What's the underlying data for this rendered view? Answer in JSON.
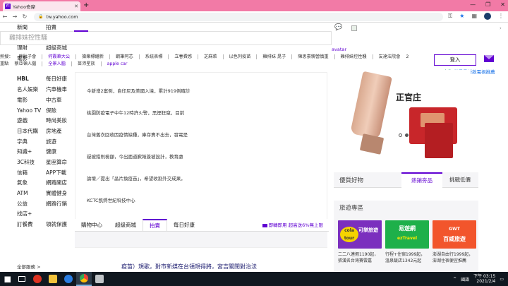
{
  "browser": {
    "tab_title": "Yahoo奇摩",
    "tab_favicon": "Y!",
    "new_tab_label": "+",
    "url": "tw.yahoo.com",
    "window_controls": [
      "—",
      "❐",
      "✕"
    ]
  },
  "header": {
    "search_placeholder": "雞排妹控性騷",
    "login_label": "登入",
    "avatar_label": "avatar",
    "ad_choice_label": "廣告",
    "ad_choice_extra": "業界最新款電視推薦"
  },
  "left_nav": {
    "col1": [
      "新聞",
      "",
      "理財",
      "電影",
      "",
      "HBL",
      "名人娛樂",
      "電影",
      "Yahoo TV",
      "遊戲",
      "日本代購",
      "字典",
      "知識+",
      "3C科技",
      "信箱",
      "氣象",
      "ATM",
      "公益",
      "找店+",
      "訂餐費"
    ],
    "col2": [
      "拍賣",
      "",
      "超級商城",
      "",
      "",
      "每日好康",
      "汽車機車",
      "中古車",
      "保險",
      "時尚美妝",
      "房地產",
      "旅遊",
      "健康",
      "星座算命",
      "APP下載",
      "網路開店",
      "實體健身",
      "網路行銷",
      "",
      "領就保護"
    ],
    "all_services": "全部服務 >"
  },
  "trending": {
    "row1": [
      "熱搜：",
      "胖肚子會",
      "何霞華大公",
      "搶樂標繼新",
      "鋼筆阿芯",
      "系統表標",
      "立春費感",
      "芝麻菜",
      "以色列疫苗",
      "雞排妹 晁子",
      "陳思豪親營慎重",
      "雞排妹控性騷",
      "友達法院會",
      "2"
    ],
    "row2": [
      "重點",
      "蔡亞頓人腦",
      "全景人腦",
      "苗沛星族",
      "apple car"
    ]
  },
  "news": [
    "今新增2案例，自印尼及美國入境，累計919例確診",
    "桃園防疫電子中午12時許火警，黑煙狂竄，目前",
    "台灣舊衣回收因疫情缺種，庫存賣不出去，發電是",
    "疑被錯則檢額，今出面道歉報簽被設計，教育處",
    "論壇／提出「晶片換疫苗」，希望收割外交成果，",
    "KCTC凱鍀世紀科技中心"
  ],
  "bottom_tabs": {
    "tabs": [
      "購物中心",
      "超級商城",
      "拍賣",
      "每日好康"
    ],
    "active_index": 2,
    "promo": "即轉即用 超高送6%無上限"
  },
  "headline_cut": "疫苗）規歌，對市新媒在台領規得將，宮吉關閉對治法",
  "ad": {
    "title": "正官庄"
  },
  "preferred": {
    "label": "優質好物",
    "tab1": "熱銷夯品",
    "tab2": "挑戰低價"
  },
  "travel": {
    "label": "旅遊專區",
    "cards": [
      {
        "logo": "cola tour",
        "name": "可樂旅遊",
        "desc": "二二八連假1190起，張漢名台灣賽雲嘉"
      },
      {
        "logo": "ezTravel",
        "name": "易遊網",
        "desc": "行程+住宿1999起，溫泉飯店1342元起"
      },
      {
        "logo": "GWT",
        "name": "百威旅遊",
        "desc": "澎湖自由行1999起，澎湖住宿便宜推薦"
      }
    ]
  },
  "taskbar": {
    "lang": "國語",
    "time": "下午 03:15",
    "date": "2021/2/4"
  },
  "colors": {
    "tabbar": "#f27aa6",
    "brand": "#6001d2",
    "taskbar": "#101820"
  }
}
